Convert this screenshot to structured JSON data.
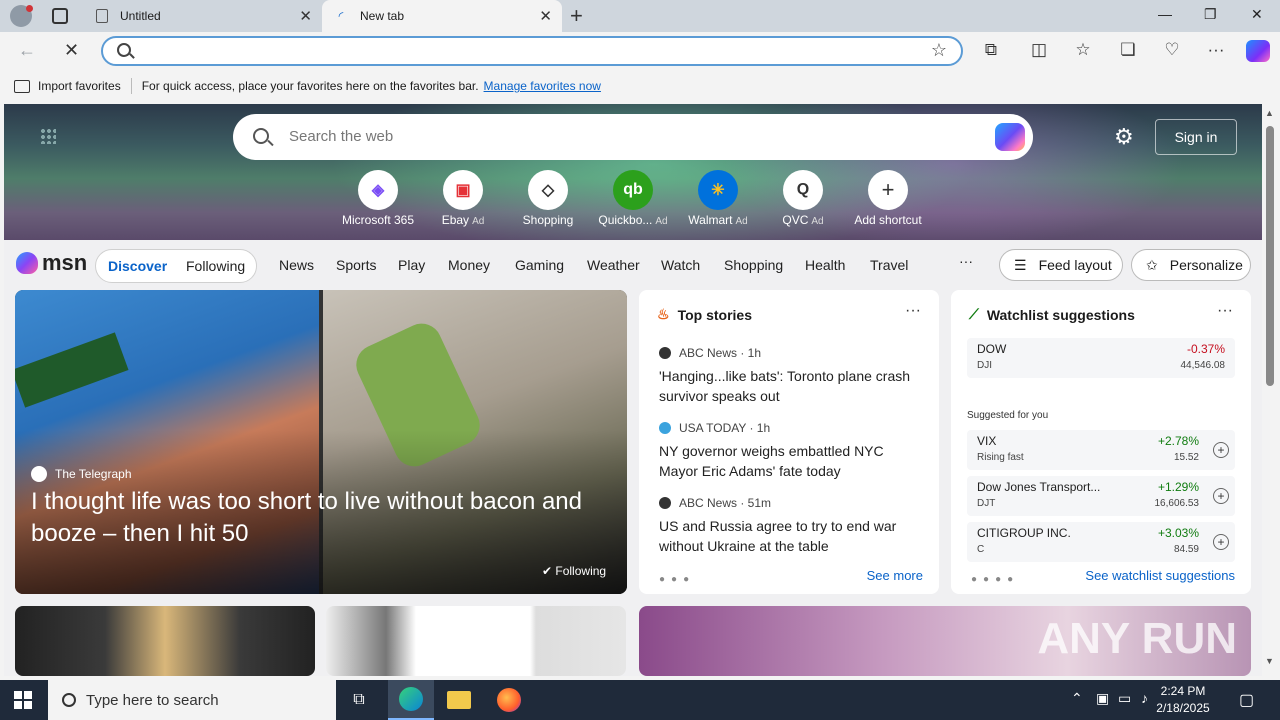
{
  "browser": {
    "tabs": [
      {
        "title": "Untitled",
        "active": false
      },
      {
        "title": "New tab",
        "active": true
      }
    ],
    "address_value": ""
  },
  "favorites_bar": {
    "import_label": "Import favorites",
    "message": "For quick access, place your favorites here on the favorites bar.",
    "manage_link": "Manage favorites now"
  },
  "hero": {
    "search_placeholder": "Search the web",
    "signin_label": "Sign in",
    "shortcuts": [
      {
        "label": "Microsoft 365",
        "ad": "",
        "icon": "microsoft-365-icon"
      },
      {
        "label": "Ebay",
        "ad": "Ad",
        "icon": "ebay-icon"
      },
      {
        "label": "Shopping",
        "ad": "",
        "icon": "tag-icon"
      },
      {
        "label": "Quickbo...",
        "ad": "Ad",
        "icon": "quickbooks-icon"
      },
      {
        "label": "Walmart",
        "ad": "Ad",
        "icon": "walmart-icon"
      },
      {
        "label": "QVC",
        "ad": "Ad",
        "icon": "qvc-icon"
      },
      {
        "label": "Add shortcut",
        "ad": "",
        "icon": "plus-icon"
      }
    ]
  },
  "msn_nav": {
    "logo": "msn",
    "discover": "Discover",
    "following": "Following",
    "items": [
      "News",
      "Sports",
      "Play",
      "Money",
      "Gaming",
      "Weather",
      "Watch",
      "Shopping",
      "Health",
      "Travel"
    ],
    "more": "···",
    "feed_layout": "Feed layout",
    "personalize": "Personalize"
  },
  "main_story": {
    "source": "The Telegraph",
    "headline": "I thought life was too short to live without bacon and booze – then I hit 50",
    "following": "Following"
  },
  "top_stories": {
    "title": "Top stories",
    "stories": [
      {
        "source": "ABC News · 1h",
        "title": "'Hanging...like bats': Toronto plane crash survivor speaks out"
      },
      {
        "source": "USA TODAY · 1h",
        "title": "NY governor weighs embattled NYC Mayor Eric Adams' fate today"
      },
      {
        "source": "ABC News · 51m",
        "title": "US and Russia agree to try to end war without Ukraine at the table"
      }
    ],
    "see_more": "See more"
  },
  "watchlist": {
    "title": "Watchlist suggestions",
    "main": {
      "name": "DOW",
      "symbol": "DJI",
      "change": "-0.37%",
      "value": "44,546.08"
    },
    "suggested_label": "Suggested for you",
    "suggested": [
      {
        "name": "VIX",
        "sub": "Rising fast",
        "change": "+2.78%",
        "value": "15.52"
      },
      {
        "name": "Dow Jones Transport...",
        "sub": "DJT",
        "change": "+1.29%",
        "value": "16,606.53"
      },
      {
        "name": "CITIGROUP INC.",
        "sub": "C",
        "change": "+3.03%",
        "value": "84.59"
      }
    ],
    "see_link": "See watchlist suggestions"
  },
  "taskbar": {
    "search_placeholder": "Type here to search",
    "time": "2:24 PM",
    "date": "2/18/2025"
  },
  "watermark": "ANY RUN"
}
